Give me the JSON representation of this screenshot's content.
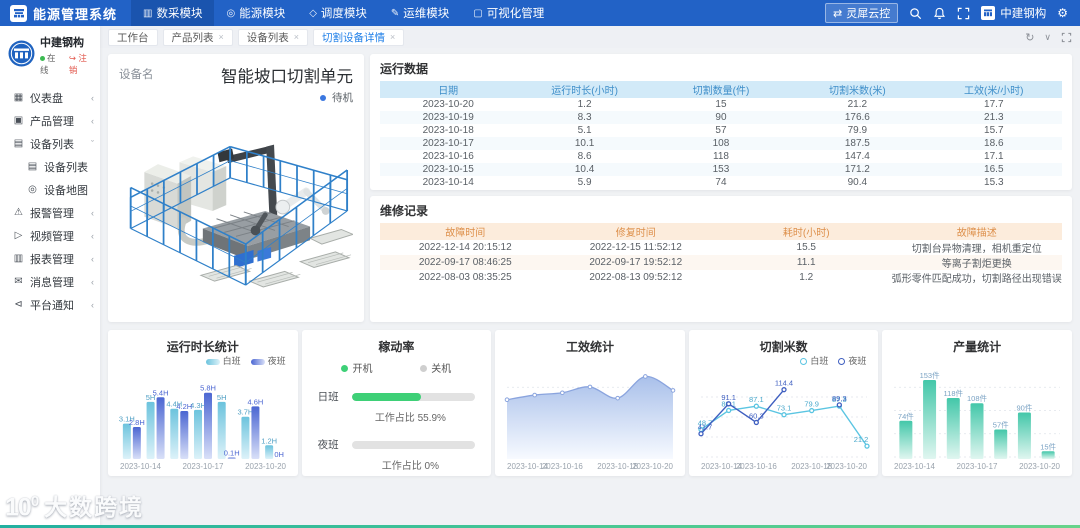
{
  "navbar": {
    "brand": "能源管理系统",
    "menu": [
      {
        "label": "数采模块",
        "icon": "data-collect-icon",
        "glyph": "▥",
        "active": true
      },
      {
        "label": "能源模块",
        "icon": "energy-icon",
        "glyph": "◎",
        "active": false
      },
      {
        "label": "调度模块",
        "icon": "dispatch-icon",
        "glyph": "◇",
        "active": false
      },
      {
        "label": "运维模块",
        "icon": "ops-icon",
        "glyph": "✎",
        "active": false
      },
      {
        "label": "可视化管理",
        "icon": "visual-icon",
        "glyph": "▢",
        "active": false
      }
    ],
    "cloud_label": "灵犀云控",
    "cloud_glyph": "⇄",
    "company": "中建钢构",
    "gear_glyph": "⚙"
  },
  "tabbar": {
    "tabs": [
      {
        "label": "工作台",
        "closable": false,
        "active": false
      },
      {
        "label": "产品列表",
        "closable": true,
        "active": false
      },
      {
        "label": "设备列表",
        "closable": true,
        "active": false
      },
      {
        "label": "切割设备详情",
        "closable": true,
        "active": true
      }
    ],
    "refresh_glyph": "↻",
    "collapse_glyph": "∨"
  },
  "sidebar": {
    "org_name": "中建钢构",
    "status_online": "在线",
    "status_logout": "注销",
    "logout_glyph": "↪",
    "items": [
      {
        "label": "仪表盘",
        "icon": "dashboard-icon",
        "glyph": "▦",
        "chevron": "‹",
        "sub": false
      },
      {
        "label": "产品管理",
        "icon": "product-icon",
        "glyph": "▣",
        "chevron": "‹",
        "sub": false
      },
      {
        "label": "设备列表",
        "icon": "device-list-icon",
        "glyph": "▤",
        "chevron": "ˇ",
        "sub": false
      },
      {
        "label": "设备列表",
        "icon": "device-list-icon",
        "glyph": "▤",
        "chevron": "",
        "sub": true
      },
      {
        "label": "设备地图",
        "icon": "device-map-icon",
        "glyph": "◎",
        "chevron": "",
        "sub": true
      },
      {
        "label": "报警管理",
        "icon": "alarm-icon",
        "glyph": "⚠",
        "chevron": "‹",
        "sub": false
      },
      {
        "label": "视频管理",
        "icon": "video-icon",
        "glyph": "▷",
        "chevron": "‹",
        "sub": false
      },
      {
        "label": "报表管理",
        "icon": "report-icon",
        "glyph": "▥",
        "chevron": "‹",
        "sub": false
      },
      {
        "label": "消息管理",
        "icon": "message-icon",
        "glyph": "✉",
        "chevron": "‹",
        "sub": false
      },
      {
        "label": "平台通知",
        "icon": "notice-icon",
        "glyph": "⊲",
        "chevron": "‹",
        "sub": false
      }
    ]
  },
  "device": {
    "label": "设备名",
    "name": "智能坡口切割单元",
    "status": "待机",
    "status_color": "#3a77e0"
  },
  "running_table": {
    "title": "运行数据",
    "headers": [
      "日期",
      "运行时长(小时)",
      "切割数量(件)",
      "切割米数(米)",
      "工效(米/小时)"
    ],
    "rows": [
      [
        "2023-10-20",
        "1.2",
        "15",
        "21.2",
        "17.7"
      ],
      [
        "2023-10-19",
        "8.3",
        "90",
        "176.6",
        "21.3"
      ],
      [
        "2023-10-18",
        "5.1",
        "57",
        "79.9",
        "15.7"
      ],
      [
        "2023-10-17",
        "10.1",
        "108",
        "187.5",
        "18.6"
      ],
      [
        "2023-10-16",
        "8.6",
        "118",
        "147.4",
        "17.1"
      ],
      [
        "2023-10-15",
        "10.4",
        "153",
        "171.2",
        "16.5"
      ],
      [
        "2023-10-14",
        "5.9",
        "74",
        "90.4",
        "15.3"
      ]
    ]
  },
  "repair_table": {
    "title": "维修记录",
    "headers": [
      "故障时间",
      "修复时间",
      "耗时(小时)",
      "故障描述"
    ],
    "rows": [
      [
        "2022-12-14 20:15:12",
        "2022-12-15 11:52:12",
        "15.5",
        "切割台异物清理，相机重定位"
      ],
      [
        "2022-09-17 08:46:25",
        "2022-09-17 19:52:12",
        "11.1",
        "等离子割炬更换"
      ],
      [
        "2022-08-03 08:35:25",
        "2022-08-13 09:52:12",
        "1.2",
        "弧形零件匹配成功，切割路径出现错误"
      ]
    ]
  },
  "chart_data": [
    {
      "type": "bar",
      "title": "运行时长统计",
      "categories": [
        "2023-10-14",
        "2023-10-15",
        "2023-10-16",
        "2023-10-17",
        "2023-10-18",
        "2023-10-19",
        "2023-10-20"
      ],
      "tick_indices": [
        0,
        3,
        6
      ],
      "series": [
        {
          "name": "白班",
          "values": [
            3.1,
            5,
            4.4,
            4.3,
            5,
            3.7,
            1.2
          ],
          "color": "#6cc3dd",
          "color_bottom": "#ddf2f9",
          "label_color": "#4f9fc4"
        },
        {
          "name": "夜班",
          "values": [
            2.8,
            5.4,
            4.2,
            5.8,
            0.1,
            4.6,
            0
          ],
          "color": "#4b66d2",
          "color_bottom": "#d9e0f8",
          "label_color": "#4b66d2"
        }
      ],
      "unit": "H",
      "ylim": [
        0,
        7
      ],
      "legend_position": "top-right",
      "grid": false
    },
    {
      "type": "progress",
      "title": "稼动率",
      "legend": [
        {
          "label": "开机",
          "color": "#3ed077"
        },
        {
          "label": "关机",
          "color": "#cfcfcf"
        }
      ],
      "rows": [
        {
          "label": "日班",
          "percent": 55.9,
          "caption": "工作占比 55.9%"
        },
        {
          "label": "夜班",
          "percent": 0,
          "caption": "工作占比 0%"
        }
      ]
    },
    {
      "type": "area",
      "title": "工效统计",
      "categories": [
        "2023-10-14",
        "2023-10-15",
        "2023-10-16",
        "2023-10-17",
        "2023-10-18",
        "2023-10-19",
        "2023-10-20"
      ],
      "tick_indices": [
        0,
        2,
        4,
        6
      ],
      "values": [
        15.3,
        16.5,
        17.1,
        18.6,
        15.7,
        21.3,
        17.7
      ],
      "ylim": [
        0,
        24
      ],
      "line_color": "#8aa4de",
      "fill_top": "#a9c0ea",
      "fill_bottom": "#f7faff",
      "grid": true
    },
    {
      "type": "line",
      "title": "切割米数",
      "categories": [
        "2023-10-14",
        "2023-10-15",
        "2023-10-16",
        "2023-10-17",
        "2023-10-18",
        "2023-10-19",
        "2023-10-20"
      ],
      "tick_indices": [
        0,
        2,
        4,
        6
      ],
      "series": [
        {
          "name": "白班",
          "values": [
            48.7,
            80.1,
            87.1,
            73.1,
            79.9,
            87.3,
            21.2
          ],
          "color": "#5bc5e2",
          "label_color": "#4aa9cc"
        },
        {
          "name": "夜班",
          "values": [
            41.7,
            91.1,
            60.3,
            114.4,
            null,
            89.3,
            null
          ],
          "color": "#3f5fc0",
          "label_color": "#3f5fc0"
        }
      ],
      "ylim": [
        0,
        132
      ],
      "legend_position": "top-right",
      "grid": true
    },
    {
      "type": "bar",
      "title": "产量统计",
      "categories": [
        "2023-10-14",
        "2023-10-15",
        "2023-10-16",
        "2023-10-17",
        "2023-10-18",
        "2023-10-19",
        "2023-10-20"
      ],
      "tick_indices": [
        0,
        3,
        6
      ],
      "series": [
        {
          "name": "产量",
          "values": [
            74,
            153,
            118,
            108,
            57,
            90,
            15
          ],
          "color": "#43c7a9",
          "color_bottom": "#e0f6f0",
          "label_color": "#7ba3c4"
        }
      ],
      "unit": "件",
      "ylim": [
        0,
        180
      ],
      "legend_position": "none",
      "grid": true
    }
  ],
  "watermark": {
    "logo": "10",
    "logo_sup": "0",
    "text": "大数跨境"
  },
  "colors": {
    "navbar": "#2262c6",
    "nav_active": "#1a54ae",
    "accent": "#1f7fe8",
    "table_blue_bg": "#d2eaf8",
    "table_blue_text": "#3e8ec9",
    "table_orange_bg": "#fcecdc",
    "table_orange_text": "#dd8f4a",
    "online_green": "#3cba52",
    "fence_blue": "#2f80c9",
    "strip_gradient": [
      "#22b0a0",
      "#67d38a"
    ]
  }
}
